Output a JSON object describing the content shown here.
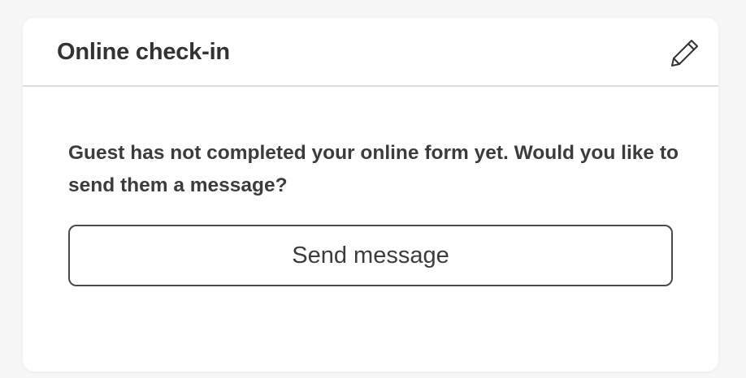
{
  "card": {
    "title": "Online check-in",
    "edit_icon": "pencil-icon",
    "message": "Guest has not completed your online form yet. Would you like to send them a message?",
    "send_button_label": "Send message"
  },
  "colors": {
    "background": "#f7f7f7",
    "card": "#ffffff",
    "text": "#333333",
    "divider": "#dcdcdc",
    "button_border": "#4a4a4a"
  }
}
